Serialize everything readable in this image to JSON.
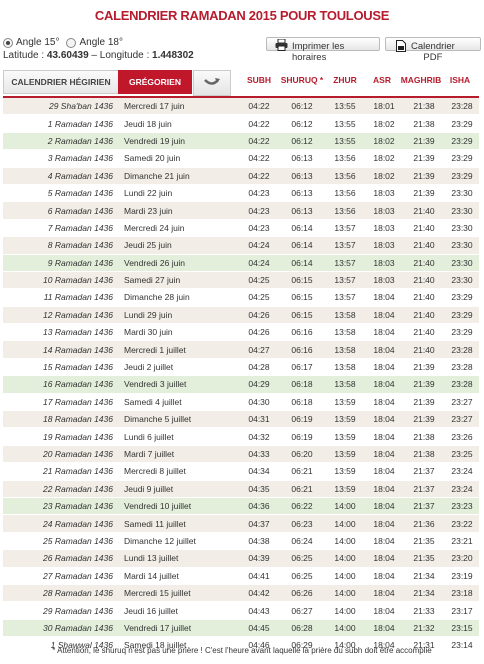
{
  "title": "CALENDRIER RAMADAN 2015 POUR TOULOUSE",
  "options": {
    "angle15": "Angle 15°",
    "angle18": "Angle 18°",
    "latitude_label": "Latitude : ",
    "latitude": "43.60439",
    "longitude_label": " – Longitude : ",
    "longitude": "1.448302"
  },
  "buttons": {
    "print_line1": "Imprimer les",
    "print_line2": "horaires",
    "pdf_line1": "Calendrier",
    "pdf_line2": "PDF"
  },
  "tabs": {
    "hegirien": "CALENDRIER HÉGIRIEN",
    "gregorien": "GRÉGORIEN"
  },
  "columns": {
    "subh": "SUBH",
    "shuruq": "SHURUQ *",
    "zhur": "ZHUR",
    "asr": "ASR",
    "maghrib": "MAGHRIB",
    "isha": "ISHA"
  },
  "colors": {
    "accent": "#b71c2e",
    "friday": "#e3efdb",
    "odd": "#f2ede6"
  },
  "rows": [
    [
      "29 Sha'ban 1436",
      "Mercredi 17 juin",
      "04:22",
      "06:12",
      "13:55",
      "18:01",
      "21:38",
      "23:28"
    ],
    [
      "1 Ramadan 1436",
      "Jeudi 18 juin",
      "04:22",
      "06:12",
      "13:55",
      "18:02",
      "21:38",
      "23:29"
    ],
    [
      "2 Ramadan 1436",
      "Vendredi 19 juin",
      "04:22",
      "06:12",
      "13:55",
      "18:02",
      "21:39",
      "23:29"
    ],
    [
      "3 Ramadan 1436",
      "Samedi 20 juin",
      "04:22",
      "06:13",
      "13:56",
      "18:02",
      "21:39",
      "23:29"
    ],
    [
      "4 Ramadan 1436",
      "Dimanche 21 juin",
      "04:22",
      "06:13",
      "13:56",
      "18:02",
      "21:39",
      "23:29"
    ],
    [
      "5 Ramadan 1436",
      "Lundi 22 juin",
      "04:23",
      "06:13",
      "13:56",
      "18:03",
      "21:39",
      "23:30"
    ],
    [
      "6 Ramadan 1436",
      "Mardi 23 juin",
      "04:23",
      "06:13",
      "13:56",
      "18:03",
      "21:40",
      "23:30"
    ],
    [
      "7 Ramadan 1436",
      "Mercredi 24 juin",
      "04:23",
      "06:14",
      "13:57",
      "18:03",
      "21:40",
      "23:30"
    ],
    [
      "8 Ramadan 1436",
      "Jeudi 25 juin",
      "04:24",
      "06:14",
      "13:57",
      "18:03",
      "21:40",
      "23:30"
    ],
    [
      "9 Ramadan 1436",
      "Vendredi 26 juin",
      "04:24",
      "06:14",
      "13:57",
      "18:03",
      "21:40",
      "23:30"
    ],
    [
      "10 Ramadan 1436",
      "Samedi 27 juin",
      "04:25",
      "06:15",
      "13:57",
      "18:03",
      "21:40",
      "23:30"
    ],
    [
      "11 Ramadan 1436",
      "Dimanche 28 juin",
      "04:25",
      "06:15",
      "13:57",
      "18:04",
      "21:40",
      "23:29"
    ],
    [
      "12 Ramadan 1436",
      "Lundi 29 juin",
      "04:26",
      "06:15",
      "13:58",
      "18:04",
      "21:40",
      "23:29"
    ],
    [
      "13 Ramadan 1436",
      "Mardi 30 juin",
      "04:26",
      "06:16",
      "13:58",
      "18:04",
      "21:40",
      "23:29"
    ],
    [
      "14 Ramadan 1436",
      "Mercredi 1 juillet",
      "04:27",
      "06:16",
      "13:58",
      "18:04",
      "21:40",
      "23:28"
    ],
    [
      "15 Ramadan 1436",
      "Jeudi 2 juillet",
      "04:28",
      "06:17",
      "13:58",
      "18:04",
      "21:39",
      "23:28"
    ],
    [
      "16 Ramadan 1436",
      "Vendredi 3 juillet",
      "04:29",
      "06:18",
      "13:58",
      "18:04",
      "21:39",
      "23:28"
    ],
    [
      "17 Ramadan 1436",
      "Samedi 4 juillet",
      "04:30",
      "06:18",
      "13:59",
      "18:04",
      "21:39",
      "23:27"
    ],
    [
      "18 Ramadan 1436",
      "Dimanche 5 juillet",
      "04:31",
      "06:19",
      "13:59",
      "18:04",
      "21:39",
      "23:27"
    ],
    [
      "19 Ramadan 1436",
      "Lundi 6 juillet",
      "04:32",
      "06:19",
      "13:59",
      "18:04",
      "21:38",
      "23:26"
    ],
    [
      "20 Ramadan 1436",
      "Mardi 7 juillet",
      "04:33",
      "06:20",
      "13:59",
      "18:04",
      "21:38",
      "23:25"
    ],
    [
      "21 Ramadan 1436",
      "Mercredi 8 juillet",
      "04:34",
      "06:21",
      "13:59",
      "18:04",
      "21:37",
      "23:24"
    ],
    [
      "22 Ramadan 1436",
      "Jeudi 9 juillet",
      "04:35",
      "06:21",
      "13:59",
      "18:04",
      "21:37",
      "23:24"
    ],
    [
      "23 Ramadan 1436",
      "Vendredi 10 juillet",
      "04:36",
      "06:22",
      "14:00",
      "18:04",
      "21:37",
      "23:23"
    ],
    [
      "24 Ramadan 1436",
      "Samedi 11 juillet",
      "04:37",
      "06:23",
      "14:00",
      "18:04",
      "21:36",
      "23:22"
    ],
    [
      "25 Ramadan 1436",
      "Dimanche 12 juillet",
      "04:38",
      "06:24",
      "14:00",
      "18:04",
      "21:35",
      "23:21"
    ],
    [
      "26 Ramadan 1436",
      "Lundi 13 juillet",
      "04:39",
      "06:25",
      "14:00",
      "18:04",
      "21:35",
      "23:20"
    ],
    [
      "27 Ramadan 1436",
      "Mardi 14 juillet",
      "04:41",
      "06:25",
      "14:00",
      "18:04",
      "21:34",
      "23:19"
    ],
    [
      "28 Ramadan 1436",
      "Mercredi 15 juillet",
      "04:42",
      "06:26",
      "14:00",
      "18:04",
      "21:34",
      "23:18"
    ],
    [
      "29 Ramadan 1436",
      "Jeudi 16 juillet",
      "04:43",
      "06:27",
      "14:00",
      "18:04",
      "21:33",
      "23:17"
    ],
    [
      "30 Ramadan 1436",
      "Vendredi 17 juillet",
      "04:45",
      "06:28",
      "14:00",
      "18:04",
      "21:32",
      "23:15"
    ],
    [
      "1 Shawwal 1436",
      "Samedi 18 juillet",
      "04:46",
      "06:29",
      "14:00",
      "18:04",
      "21:31",
      "23:14"
    ]
  ],
  "fridays": [
    2,
    9,
    16,
    23,
    30
  ],
  "footnote": "* Attention, le shuruq n'est pas une prière ! C'est l'heure avant laquelle la prière du subh doit être accomplie"
}
